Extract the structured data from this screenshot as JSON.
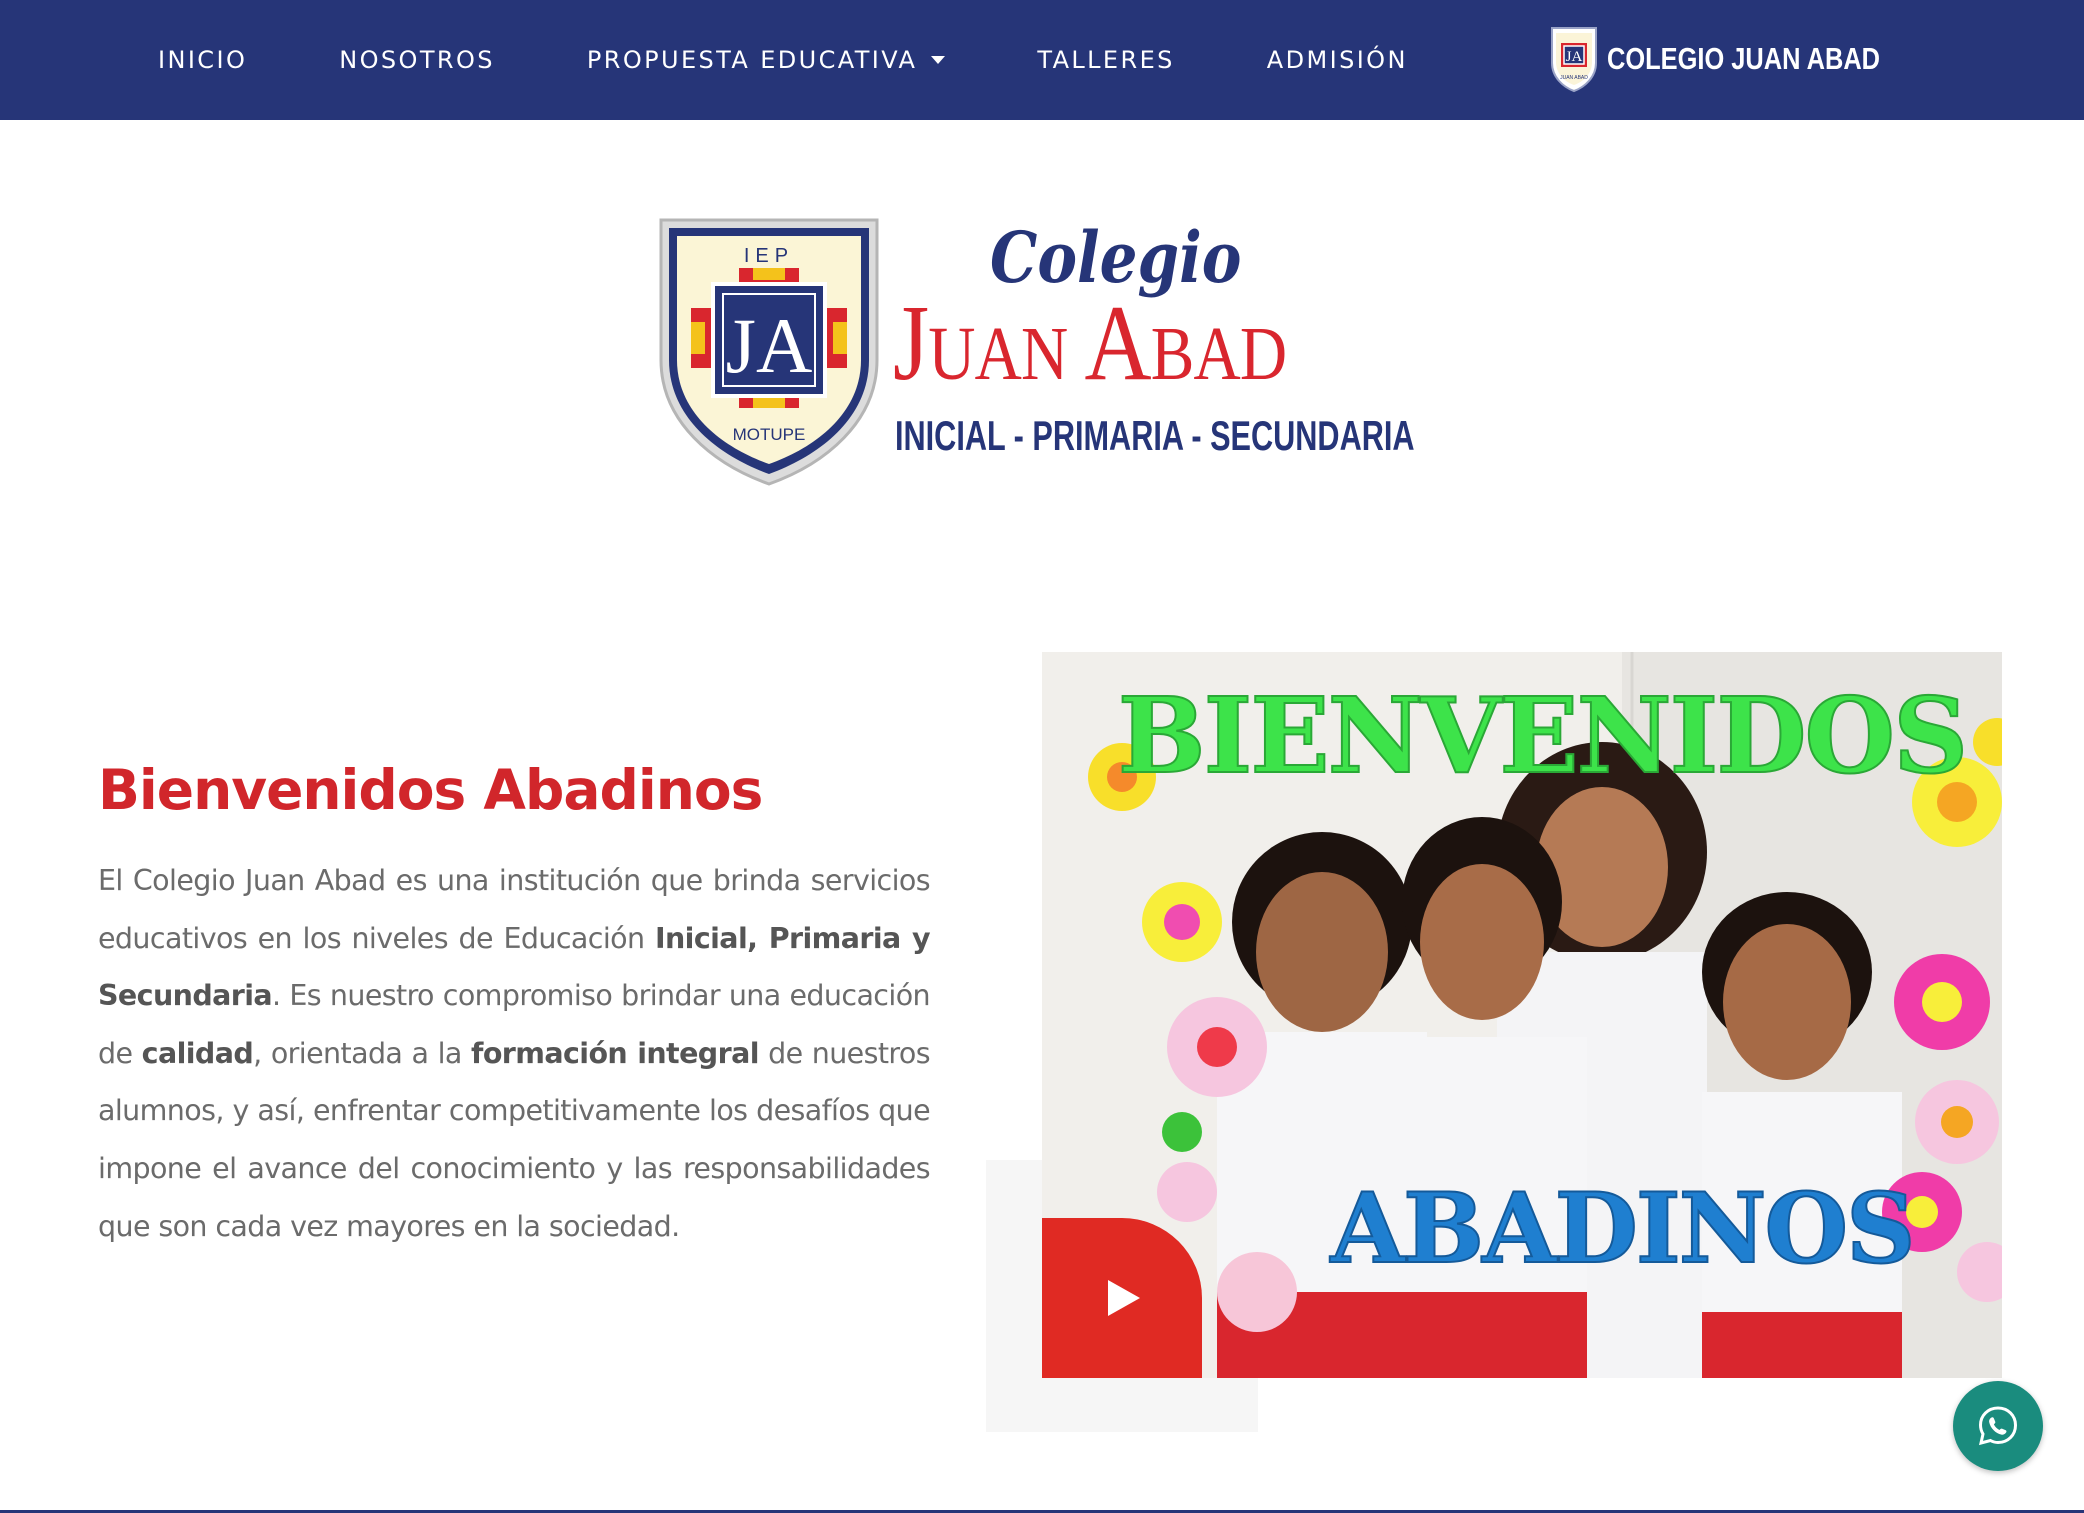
{
  "nav": {
    "links": [
      {
        "label": "INICIO"
      },
      {
        "label": "NOSOTROS"
      },
      {
        "label": "PROPUESTA EDUCATIVA"
      },
      {
        "label": "TALLERES"
      },
      {
        "label": "ADMISIÓN"
      }
    ],
    "brand_text": "COLEGIO JUAN ABAD",
    "brand_crest_letters": "JA",
    "brand_crest_caption": "JUAN ABAD"
  },
  "logo": {
    "crest_top": "IEP",
    "crest_letters": "JA",
    "crest_bottom": "MOTUPE",
    "colegio": "Colegio",
    "name": "Juan Abad",
    "levels": "INICIAL - PRIMARIA - SECUNDARIA"
  },
  "welcome": {
    "title": "Bienvenidos Abadinos",
    "p1": "El Colegio Juan Abad es una institución que brinda servicios educativos en los niveles de Educación ",
    "b1": "Inicial, Primaria y Secundaria",
    "p2": ". Es nuestro compromiso brindar una educación de ",
    "b2": "calidad",
    "p3": ", orientada a la ",
    "b3": "formación integral",
    "p4": " de nuestros alumnos, y así, enfrentar competitivamente los desafíos que impone el avance del conocimiento y las responsabilidades que son cada vez mayores en la sociedad."
  },
  "video": {
    "sign_top": "BIENVENIDOS",
    "sign_bottom": "ABADINOS",
    "play_icon": "play-icon"
  },
  "whatsapp": {
    "icon": "whatsapp-icon"
  },
  "colors": {
    "navy": "#263578",
    "red": "#d1262b",
    "play": "#e02a23",
    "whatsapp": "#1a8c7e"
  }
}
